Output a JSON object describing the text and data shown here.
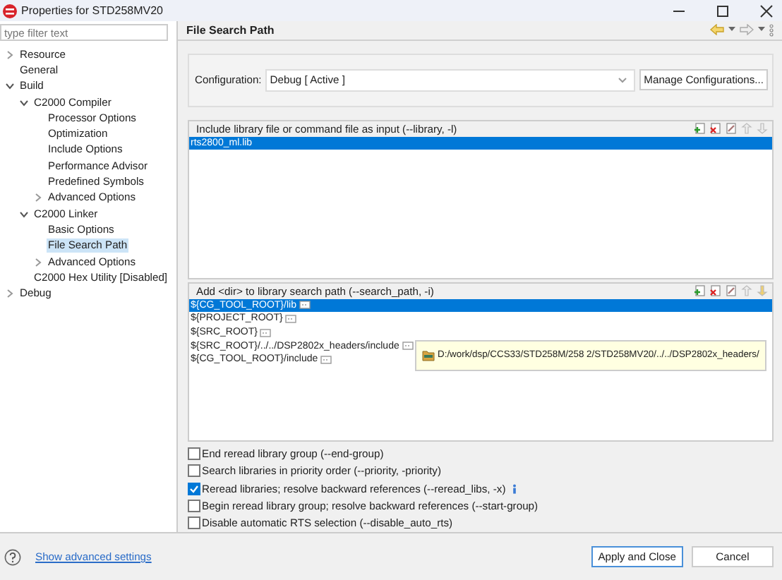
{
  "window": {
    "title": "Properties for STD258MV20"
  },
  "filter": {
    "placeholder": "type filter text"
  },
  "tree": [
    {
      "label": "Resource",
      "expanded": false,
      "selected": false
    },
    {
      "label": "General",
      "selected": false
    },
    {
      "label": "Build",
      "expanded": true,
      "selected": false,
      "children": [
        {
          "label": "C2000 Compiler",
          "expanded": true,
          "selected": false,
          "children": [
            {
              "label": "Processor Options",
              "selected": false
            },
            {
              "label": "Optimization",
              "selected": false
            },
            {
              "label": "Include Options",
              "selected": false
            },
            {
              "label": "Performance Advisor",
              "selected": false
            },
            {
              "label": "Predefined Symbols",
              "selected": false
            },
            {
              "label": "Advanced Options",
              "expanded": false,
              "selected": false
            }
          ]
        },
        {
          "label": "C2000 Linker",
          "expanded": true,
          "selected": false,
          "children": [
            {
              "label": "Basic Options",
              "selected": false
            },
            {
              "label": "File Search Path",
              "selected": true
            },
            {
              "label": "Advanced Options",
              "expanded": false,
              "selected": false
            }
          ]
        },
        {
          "label": "C2000 Hex Utility  [Disabled]",
          "selected": false
        }
      ]
    },
    {
      "label": "Debug",
      "expanded": false,
      "selected": false
    }
  ],
  "page_title": "File Search Path",
  "configuration": {
    "label": "Configuration:",
    "value": "Debug  [ Active ]",
    "button": "Manage Configurations..."
  },
  "lists": [
    {
      "kind": "library",
      "header": "Include library file or command file as input (--library, -l)",
      "items": [
        {
          "text": "rts2800_ml.lib",
          "selected": true
        }
      ]
    },
    {
      "kind": "search_path",
      "header": "Add <dir> to library search path (--search_path, -i)",
      "items": [
        {
          "text": "${CG_TOOL_ROOT}/lib",
          "selected": true
        },
        {
          "text": "${PROJECT_ROOT}",
          "selected": false
        },
        {
          "text": "${SRC_ROOT}",
          "selected": false
        },
        {
          "text": "${SRC_ROOT}/../../DSP2802x_headers/include",
          "selected": false
        },
        {
          "text": "${CG_TOOL_ROOT}/include",
          "selected": false
        }
      ]
    }
  ],
  "tooltip": {
    "text": "D:/work/dsp/CCS33/STD258M/258 2/STD258MV20/../../DSP2802x_headers/"
  },
  "options": [
    {
      "label": "End reread library group (--end-group)",
      "checked": false,
      "info": false
    },
    {
      "label": "Search libraries in priority order (--priority, -priority)",
      "checked": false,
      "info": false
    },
    {
      "label": "Reread libraries; resolve backward references (--reread_libs, -x)",
      "checked": true,
      "info": true
    },
    {
      "label": "Begin reread library group; resolve backward references (--start-group)",
      "checked": false,
      "info": false
    },
    {
      "label": "Disable automatic RTS selection (--disable_auto_rts)",
      "checked": false,
      "info": false
    }
  ],
  "footer": {
    "link": "Show advanced settings",
    "buttons": [
      "Apply and Close",
      "Cancel"
    ]
  }
}
